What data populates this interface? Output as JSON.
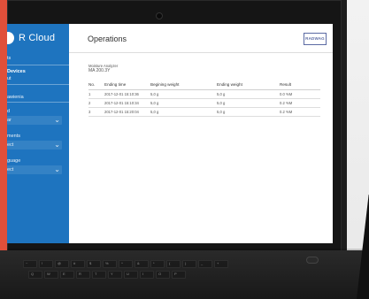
{
  "sidebar": {
    "brand_text": "R Cloud",
    "lines": {
      "top_small": "ts",
      "devices": "Devices",
      "devices_sub": "ut",
      "section_a": "awienia",
      "label_1": "d",
      "select_1": "ar",
      "label_2": "ments",
      "select_2": "ect",
      "label_3": "guage",
      "select_3": "ect"
    }
  },
  "content": {
    "title": "Operations",
    "logo_text": "RADWAG",
    "device": {
      "label": "Moisture Analyzer",
      "model": "MA 200.3Y"
    },
    "table": {
      "headers": [
        "No.",
        "Ending time",
        "Begining weight",
        "Ending weight",
        "Result"
      ],
      "rows": [
        [
          "1",
          "2017-12-01 15:10:36",
          "5,0 g",
          "5,0 g",
          "0.0 %M"
        ],
        [
          "2",
          "2017-12-01 15:10:34",
          "5,0 g",
          "5,0 g",
          "0.2 %M"
        ],
        [
          "3",
          "2017-12-01 15:20:04",
          "5,0 g",
          "5,0 g",
          "0.2 %M"
        ]
      ]
    }
  },
  "keyboard": {
    "key_glyphs": [
      "~",
      "!",
      "@",
      "#",
      "$",
      "%",
      "^",
      "&",
      "*",
      "(",
      ")",
      "_",
      "+",
      "Q",
      "W",
      "E",
      "R",
      "T",
      "Y",
      "U",
      "I",
      "O",
      "P"
    ]
  },
  "colors": {
    "accent_left": "#e04f3a",
    "sidebar": "#1e74bf",
    "logo": "#5b6aa3"
  }
}
